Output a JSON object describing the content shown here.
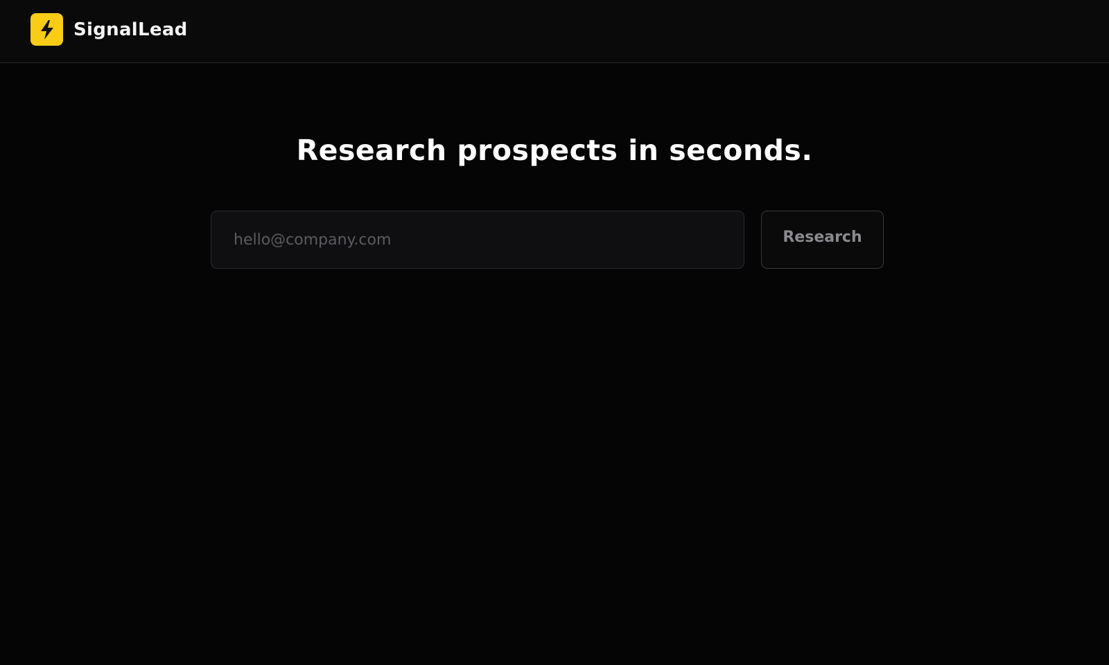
{
  "header": {
    "brand_name": "SignalLead",
    "logo_icon": "lightning-bolt-icon",
    "logo_color": "#FACC15"
  },
  "main": {
    "headline": "Research prospects in seconds.",
    "search": {
      "placeholder": "hello@company.com",
      "value": ""
    },
    "research_button_label": "Research"
  },
  "colors": {
    "background": "#050506",
    "accent": "#FACC15",
    "muted_text": "#8A8A8F"
  }
}
